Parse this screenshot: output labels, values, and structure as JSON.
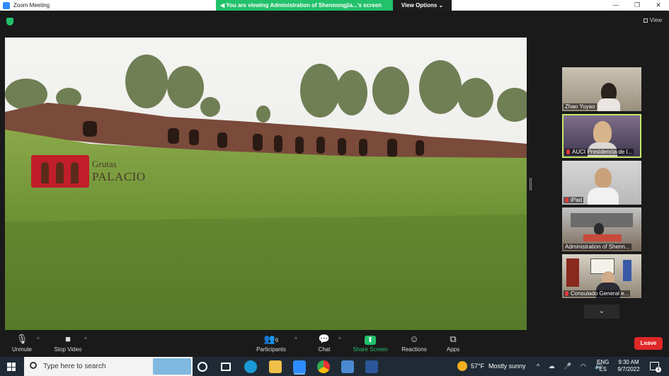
{
  "window": {
    "title": "Zoom Meeting",
    "controls": [
      "—",
      "❐",
      "✕"
    ]
  },
  "share_banner": {
    "text": "You are viewing Administration of Shennongjia...'s screen",
    "view_options": "View Options ⌄"
  },
  "top_right": {
    "view_label": "View"
  },
  "shared_content": {
    "logo_line1": "Grutas",
    "logo_line2": "PALACIO"
  },
  "participants_panel": {
    "tiles": [
      {
        "name": "Zhao Yuyao",
        "muted": false,
        "active": false
      },
      {
        "name": "AUCI Presidencia de l...",
        "muted": true,
        "active": true
      },
      {
        "name": "iPad",
        "muted": true,
        "active": false
      },
      {
        "name": "Administration of Shenn...",
        "muted": false,
        "active": false
      },
      {
        "name": "Consulado General e...",
        "muted": true,
        "active": false
      }
    ],
    "more_icon": "⌄"
  },
  "toolbar": {
    "unmute": "Unmute",
    "stop_video": "Stop Video",
    "participants": "Participants",
    "participants_count": "6",
    "chat": "Chat",
    "share_screen": "Share Screen",
    "reactions": "Reactions",
    "apps": "Apps",
    "leave": "Leave"
  },
  "taskbar": {
    "search_placeholder": "Type here to search",
    "temperature": "57°F",
    "weather": "Mostly sunny",
    "tray_icons": "^ ☁ 🎤 ◠ 🔊",
    "lang_1": "ENG",
    "lang_2": "ES",
    "time": "9:30 AM",
    "date": "9/7/2022",
    "notification_count": "1"
  },
  "colors": {
    "zoom_green": "#23c16b",
    "leave_red": "#e02828",
    "active_speaker": "#c7e86b",
    "taskbar_bg": "#1f2a35"
  }
}
